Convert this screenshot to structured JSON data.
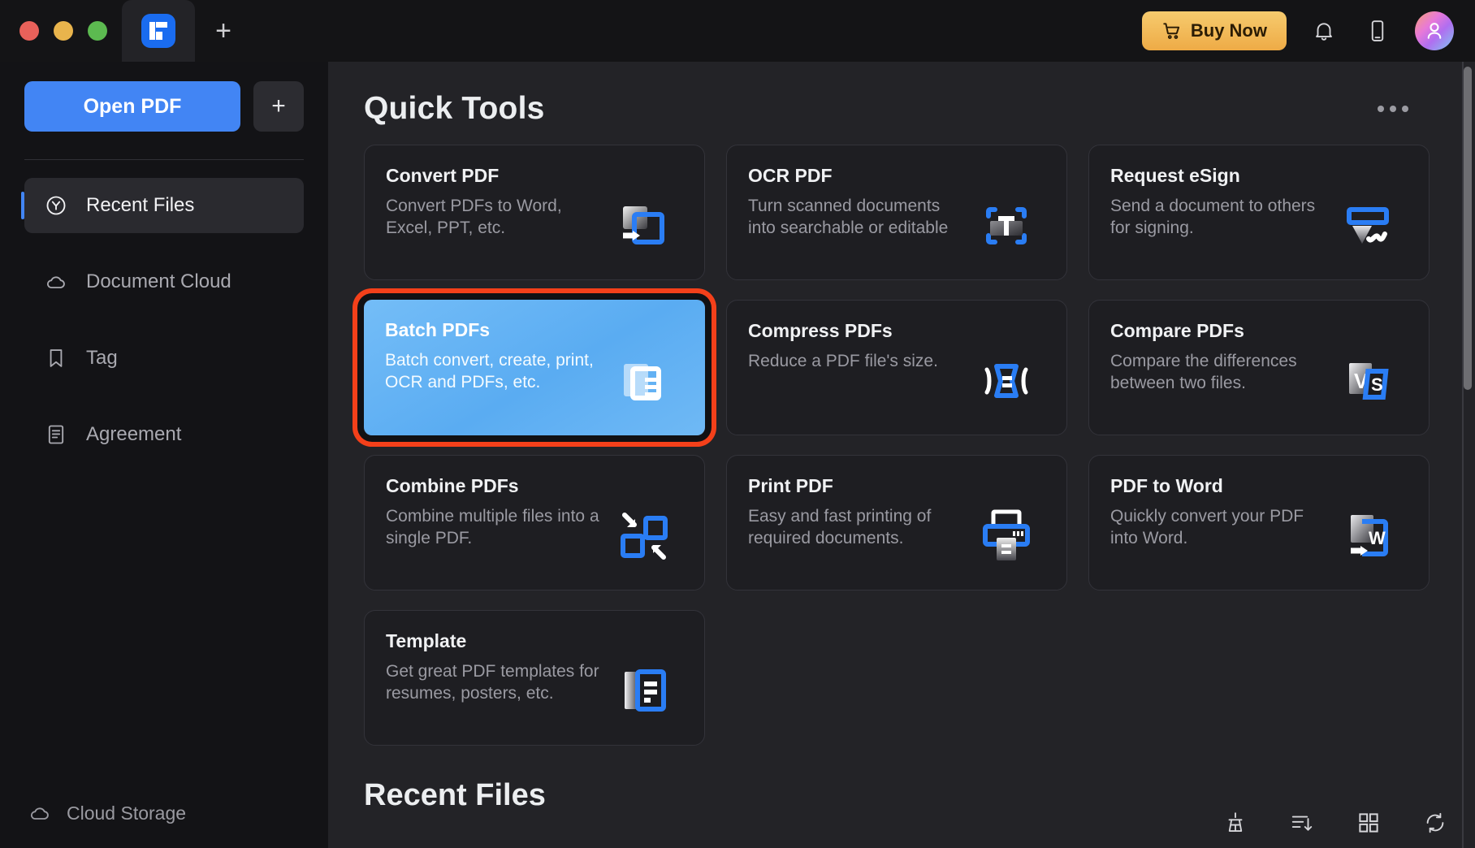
{
  "titlebar": {
    "window_controls": [
      "close",
      "minimize",
      "zoom"
    ],
    "tab_icon": "pdfelement-logo-icon",
    "new_tab_label": "+",
    "buy_now_label": "Buy Now",
    "cart_icon": "cart-icon",
    "bell_icon": "bell-icon",
    "phone_icon": "phone-icon",
    "avatar_icon": "user-avatar"
  },
  "sidebar": {
    "open_pdf_label": "Open PDF",
    "add_label": "+",
    "items": [
      {
        "label": "Recent Files",
        "icon": "clock-icon",
        "active": true
      },
      {
        "label": "Document Cloud",
        "icon": "cloud-icon",
        "active": false
      },
      {
        "label": "Tag",
        "icon": "bookmark-icon",
        "active": false
      },
      {
        "label": "Agreement",
        "icon": "document-lines-icon",
        "active": false
      }
    ],
    "bottom": {
      "label": "Cloud Storage",
      "icon": "cloud-icon"
    }
  },
  "main": {
    "quick_tools_title": "Quick Tools",
    "more_menu": "more-options-icon",
    "recent_files_title": "Recent Files",
    "cards": [
      {
        "title": "Convert PDF",
        "desc": "Convert PDFs to Word, Excel, PPT, etc.",
        "icon": "convert-pdf-icon",
        "highlighted": false
      },
      {
        "title": "OCR PDF",
        "desc": "Turn scanned documents into searchable or editable",
        "icon": "ocr-pdf-icon",
        "highlighted": false
      },
      {
        "title": "Request eSign",
        "desc": "Send a document to others for signing.",
        "icon": "request-esign-icon",
        "highlighted": false
      },
      {
        "title": "Batch PDFs",
        "desc": "Batch convert, create, print, OCR and PDFs, etc.",
        "icon": "batch-pdfs-icon",
        "highlighted": true
      },
      {
        "title": "Compress PDFs",
        "desc": "Reduce a PDF file's size.",
        "icon": "compress-pdfs-icon",
        "highlighted": false
      },
      {
        "title": "Compare PDFs",
        "desc": "Compare the differences between two files.",
        "icon": "compare-pdfs-icon",
        "highlighted": false
      },
      {
        "title": "Combine PDFs",
        "desc": "Combine multiple files into a single PDF.",
        "icon": "combine-pdfs-icon",
        "highlighted": false
      },
      {
        "title": "Print PDF",
        "desc": "Easy and fast printing of required documents.",
        "icon": "print-pdf-icon",
        "highlighted": false
      },
      {
        "title": "PDF to Word",
        "desc": "Quickly convert your PDF into Word.",
        "icon": "pdf-to-word-icon",
        "highlighted": false
      },
      {
        "title": "Template",
        "desc": "Get great PDF templates for resumes, posters, etc.",
        "icon": "template-icon",
        "highlighted": false
      }
    ],
    "bottom_tools": [
      {
        "icon": "clean-broom-icon"
      },
      {
        "icon": "sort-descending-icon"
      },
      {
        "icon": "grid-view-icon"
      },
      {
        "icon": "refresh-icon"
      }
    ]
  },
  "colors": {
    "accent_blue": "#4285f4",
    "buy_now_gold": "#eeab46",
    "highlight_ring": "#f4401a",
    "card_bg": "#1e1e22",
    "main_bg": "#232327",
    "sidebar_bg": "#131316",
    "titlebar_bg": "#141416"
  }
}
